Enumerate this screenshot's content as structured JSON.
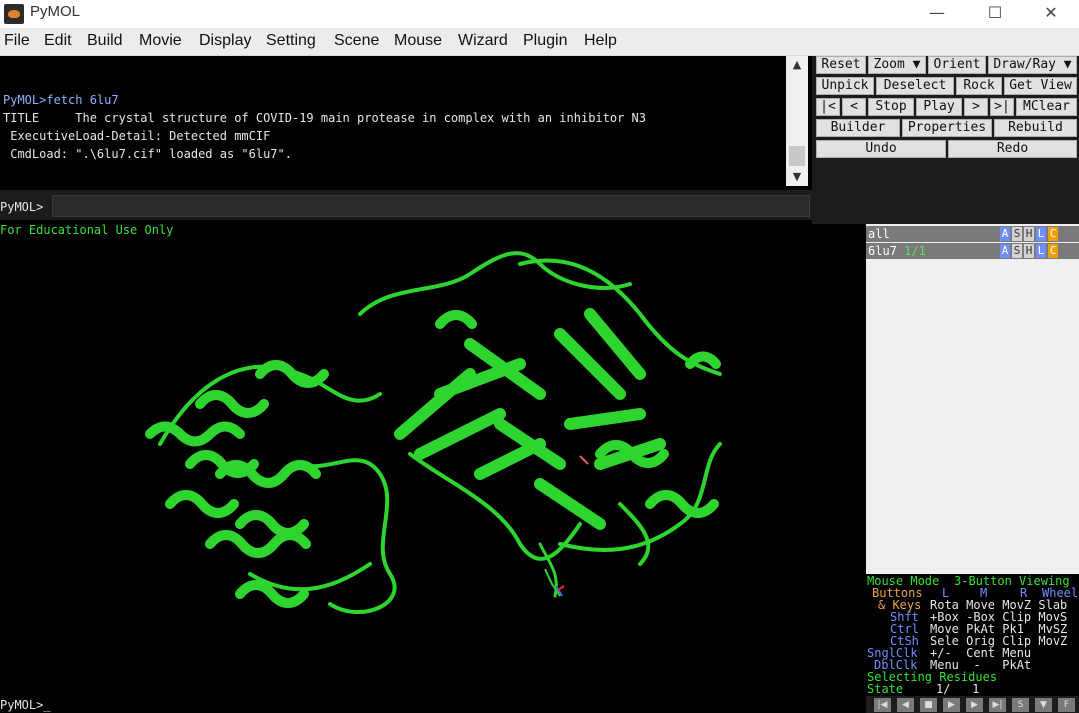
{
  "window": {
    "title": "PyMOL",
    "controls": {
      "minimize": "—",
      "maximize": "☐",
      "close": "✕"
    }
  },
  "menubar": {
    "items": [
      "File",
      "Edit",
      "Build",
      "Movie",
      "Display",
      "Setting",
      "Scene",
      "Mouse",
      "Wizard",
      "Plugin",
      "Help"
    ]
  },
  "console": {
    "lines": [
      "PyMOL>fetch 6lu7",
      "TITLE     The crystal structure of COVID-19 main protease in complex with an inhibitor N3",
      " ExecutiveLoad-Detail: Detected mmCIF",
      " CmdLoad: \".\\6lu7.cif\" loaded as \"6lu7\"."
    ]
  },
  "command": {
    "prompt": "PyMOL>",
    "value": ""
  },
  "buttons": {
    "row1": [
      "Reset",
      "Zoom ▼",
      "Orient",
      "Draw/Ray ▼"
    ],
    "row2": [
      "Unpick",
      "Deselect",
      "Rock",
      "Get View"
    ],
    "row3": [
      "|<",
      "<",
      "Stop",
      "Play",
      ">",
      ">|",
      "MClear"
    ],
    "row4": [
      "Builder",
      "Properties",
      "Rebuild"
    ],
    "row5": [
      "Undo",
      "Redo"
    ]
  },
  "viewport": {
    "label": "For Educational Use Only"
  },
  "objects": [
    {
      "name": "all",
      "state": ""
    },
    {
      "name": "6lu7",
      "state": "1/1"
    }
  ],
  "ashlc": [
    "A",
    "S",
    "H",
    "L",
    "C"
  ],
  "mouse_help": {
    "mode_label": "Mouse Mode",
    "mode_value": "3-Button Viewing",
    "buttons_label": "Buttons",
    "col_l": "L",
    "col_m": "M",
    "col_r": "R",
    "col_wheel": "Wheel",
    "rows": [
      {
        "key": "& Keys",
        "vals": "Rota Move MovZ Slab"
      },
      {
        "key": "Shft",
        "vals": "+Box -Box Clip MovS"
      },
      {
        "key": "Ctrl",
        "vals": "Move PkAt Pk1  MvSZ"
      },
      {
        "key": "CtSh",
        "vals": "Sele Orig Clip MovZ"
      },
      {
        "key": "SnglClk",
        "vals": "+/-  Cent Menu"
      },
      {
        "key": "DblClk",
        "vals": "Menu  -   PkAt"
      }
    ],
    "selecting": "Selecting Residues",
    "state_label": "State",
    "state_value": "1/   1"
  },
  "bottom": {
    "prompt": "PyMOL>_"
  },
  "movie_controls": [
    "|◀",
    "◀",
    "■",
    "▶",
    "▶",
    "▶|",
    "S",
    "▼",
    "F"
  ],
  "colors": {
    "console_text": "#e6e6e6",
    "label_green": "#33e033",
    "protein_green": "#2ed52e"
  }
}
